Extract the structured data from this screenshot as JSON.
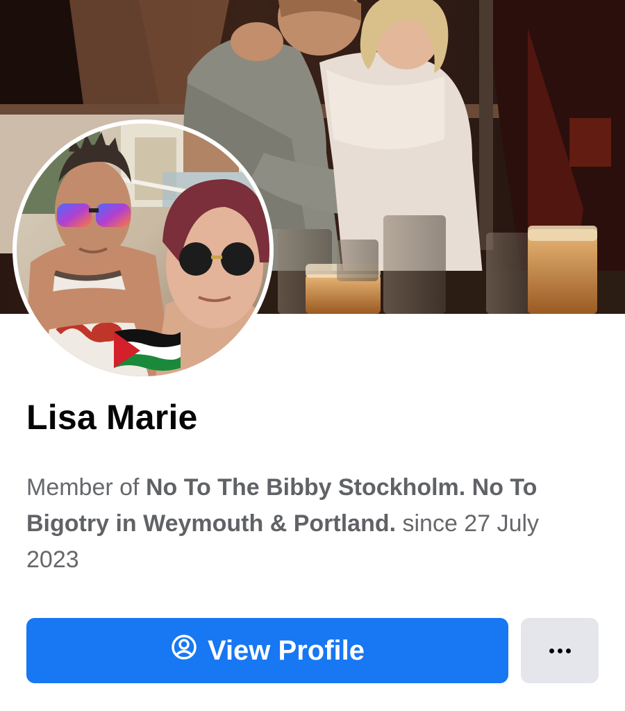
{
  "profile": {
    "name": "Lisa Marie",
    "membership": {
      "prefix": "Member of ",
      "group_name": "No To The Bibby Stockholm. No To Bigotry in Weymouth & Portland.",
      "suffix": " since 27 July 2023"
    },
    "avatar_badge": "palestine-flag"
  },
  "actions": {
    "view_profile_label": "View Profile",
    "view_profile_icon": "user-circle-icon",
    "more_icon": "more-dots-icon"
  },
  "colors": {
    "primary_button": "#1877f2",
    "secondary_button": "#e4e6eb",
    "name_text": "#050505",
    "secondary_text": "#65676b"
  }
}
